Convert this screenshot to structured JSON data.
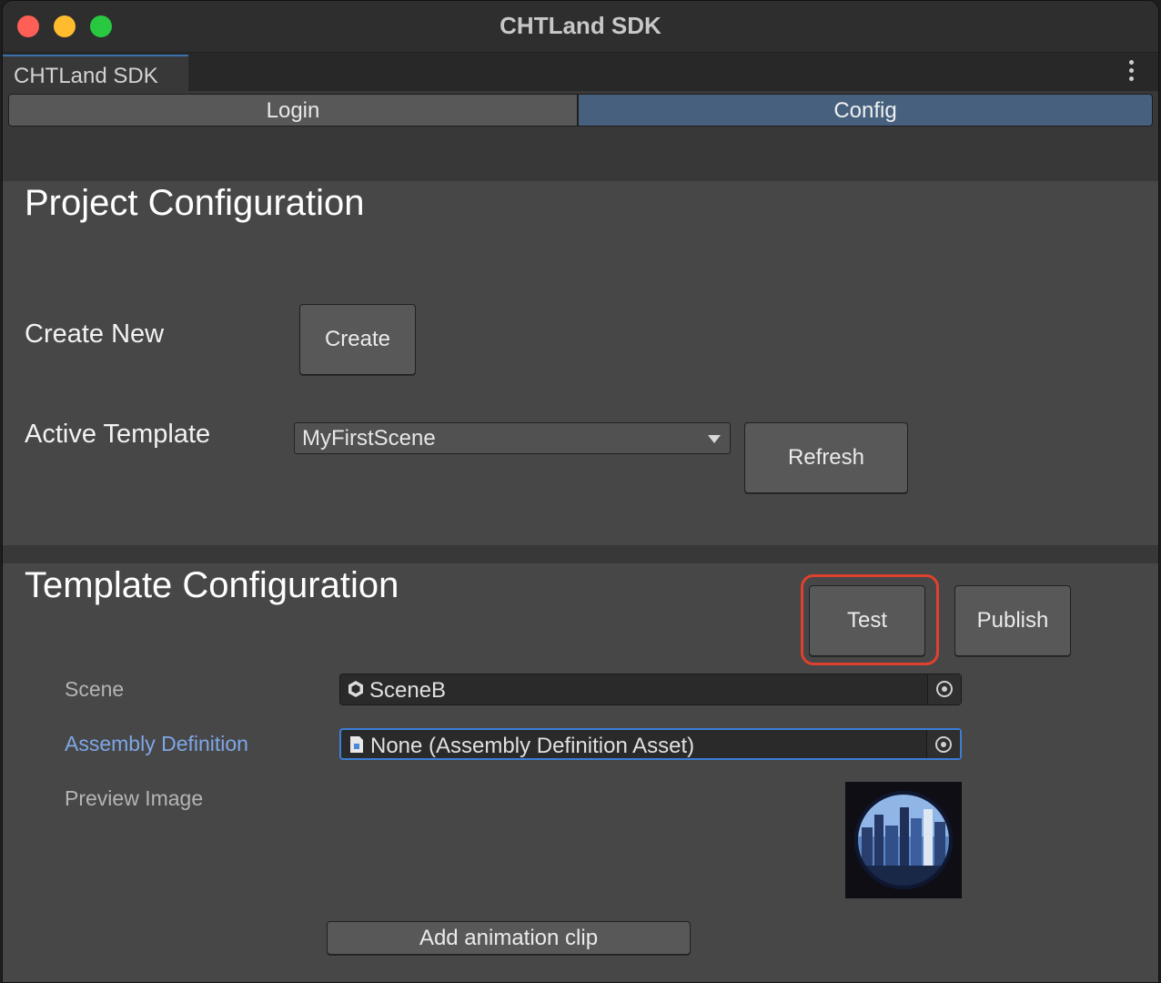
{
  "window": {
    "title": "CHTLand SDK"
  },
  "tab": {
    "label": "CHTLand SDK"
  },
  "segments": {
    "login": "Login",
    "config": "Config",
    "active": "Config"
  },
  "project": {
    "heading": "Project Configuration",
    "create_new_label": "Create New",
    "create_button": "Create",
    "active_template_label": "Active Template",
    "active_template_value": "MyFirstScene",
    "refresh_button": "Refresh"
  },
  "template": {
    "heading": "Template Configuration",
    "test_button": "Test",
    "publish_button": "Publish",
    "scene_label": "Scene",
    "scene_value": "SceneB",
    "assembly_label": "Assembly Definition",
    "assembly_value": "None (Assembly Definition Asset)",
    "preview_label": "Preview Image",
    "add_clip_button": "Add animation clip"
  },
  "colors": {
    "accent": "#46607e",
    "focus": "#3d7dd8",
    "highlight": "#e0402e",
    "link": "#7ea7e6"
  }
}
